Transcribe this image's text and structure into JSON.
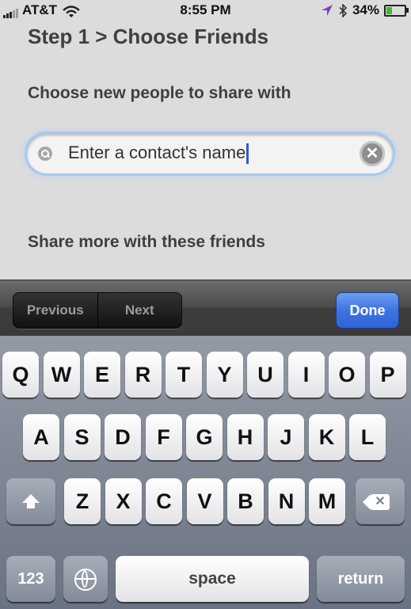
{
  "status_bar": {
    "carrier": "AT&T",
    "time": "8:55 PM",
    "battery": "34%",
    "battery_level": 0.34,
    "icons": [
      "signal-bars-icon",
      "wifi-icon",
      "location-arrow-icon",
      "bluetooth-icon",
      "battery-icon"
    ]
  },
  "page": {
    "step_title": "Step 1 > Choose Friends",
    "section_new": "Choose new people to share with",
    "search": {
      "value": "Enter a contact's name"
    },
    "section_more": "Share more with these friends"
  },
  "toolbar": {
    "previous_label": "Previous",
    "next_label": "Next",
    "done_label": "Done"
  },
  "keyboard": {
    "row1": [
      "Q",
      "W",
      "E",
      "R",
      "T",
      "Y",
      "U",
      "I",
      "O",
      "P"
    ],
    "row2": [
      "A",
      "S",
      "D",
      "F",
      "G",
      "H",
      "J",
      "K",
      "L"
    ],
    "row3": [
      "Z",
      "X",
      "C",
      "V",
      "B",
      "N",
      "M"
    ],
    "numbers_label": "123",
    "space_label": "space",
    "return_label": "return"
  },
  "colors": {
    "accent": "#3d74e2",
    "cursor": "#2f5ad3",
    "background": "#dcdcdc"
  }
}
